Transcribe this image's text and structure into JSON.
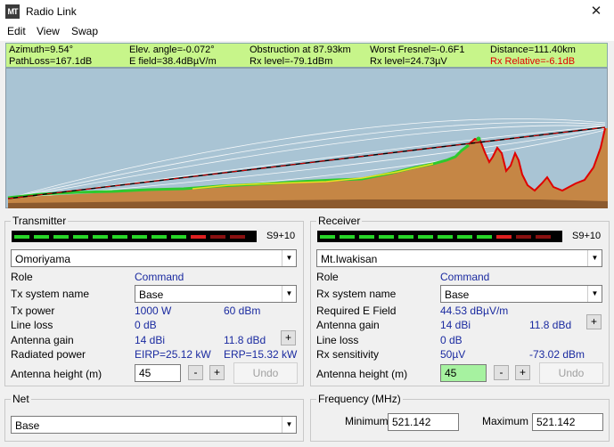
{
  "window": {
    "title": "Radio Link",
    "icon": "MT",
    "close_glyph": "✕"
  },
  "menu": [
    "Edit",
    "View",
    "Swap"
  ],
  "info": {
    "row1": [
      "Azimuth=9.54°",
      "Elev. angle=-0.072°",
      "Obstruction at 87.93km",
      "Worst Fresnel=-0.6F1",
      "Distance=111.40km"
    ],
    "row2": [
      "PathLoss=167.1dB",
      "E field=38.4dBµV/m",
      "Rx level=-79.1dBm",
      "Rx level=24.73µV",
      "Rx Relative=-6.1dB"
    ]
  },
  "colors": {
    "sky": "#a9c4d4",
    "terrain": "#c58645",
    "green_line": "#2ec92e",
    "red_line": "#e00000",
    "info_bg": "#c7f58a",
    "value_blue": "#1a2aa0"
  },
  "transmitter": {
    "title": "Transmitter",
    "signal_label": "S9+10",
    "site": "Omoriyama",
    "role_label": "Role",
    "role_value": "Command",
    "system_label": "Tx system name",
    "system_value": "Base",
    "power_label": "Tx power",
    "power_w": "1000 W",
    "power_dbm": "60 dBm",
    "loss_label": "Line loss",
    "loss_value": "0 dB",
    "gain_label": "Antenna gain",
    "gain_dbi": "14 dBi",
    "gain_dbd": "11.8 dBd",
    "radiated_label": "Radiated power",
    "eirp": "EIRP=25.12 kW",
    "erp": "ERP=15.32 kW",
    "height_label": "Antenna height (m)",
    "height_value": "45",
    "undo_label": "Undo"
  },
  "receiver": {
    "title": "Receiver",
    "signal_label": "S9+10",
    "site": "Mt.Iwakisan",
    "role_label": "Role",
    "role_value": "Command",
    "system_label": "Rx system name",
    "system_value": "Base",
    "field_label": "Required E Field",
    "field_value": "44.53 dBµV/m",
    "gain_label": "Antenna gain",
    "gain_dbi": "14 dBi",
    "gain_dbd": "11.8 dBd",
    "loss_label": "Line loss",
    "loss_value": "0 dB",
    "sens_label": "Rx sensitivity",
    "sens_uv": "50µV",
    "sens_dbm": "-73.02 dBm",
    "height_label": "Antenna height (m)",
    "height_value": "45",
    "undo_label": "Undo"
  },
  "net": {
    "title": "Net",
    "value": "Base"
  },
  "frequency": {
    "title": "Frequency (MHz)",
    "min_label": "Minimum",
    "min_value": "521.142",
    "max_label": "Maximum",
    "max_value": "521.142"
  },
  "buttons": {
    "minus": "-",
    "plus": "+"
  }
}
